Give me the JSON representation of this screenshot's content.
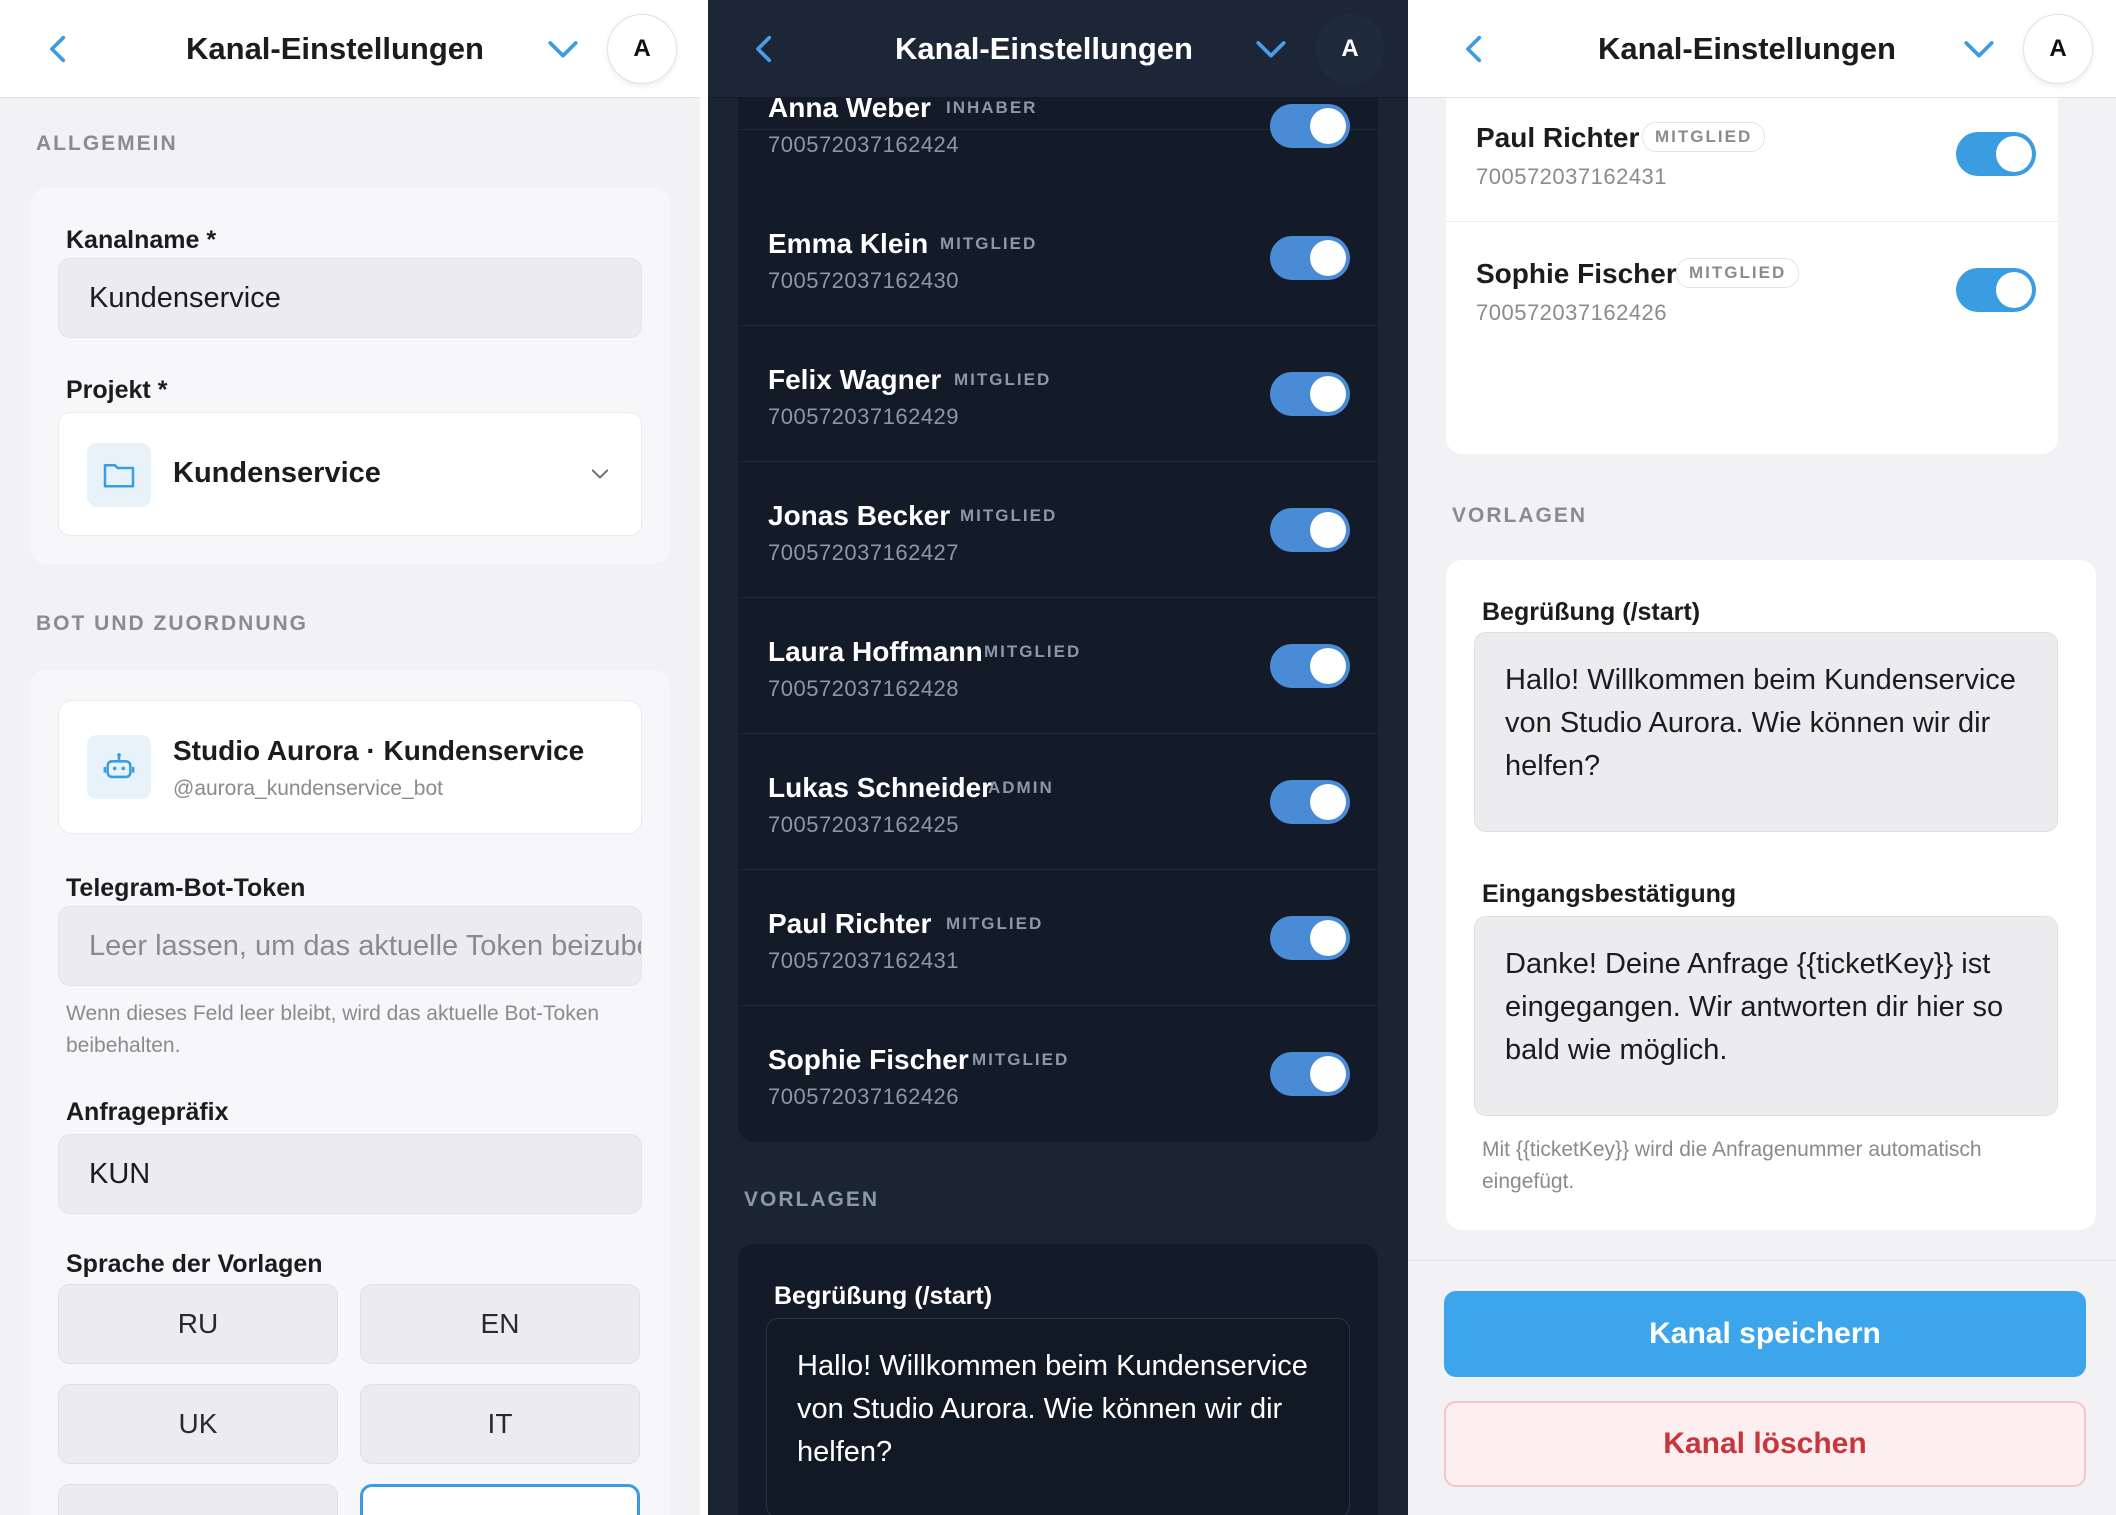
{
  "header": {
    "title": "Kanal-Einstellungen",
    "avatar": "A"
  },
  "general": {
    "section": "ALLGEMEIN",
    "channel_name_label": "Kanalname *",
    "channel_name_value": "Kundenservice",
    "project_label": "Projekt *",
    "project_value": "Kundenservice"
  },
  "bot": {
    "section": "BOT UND ZUORDNUNG",
    "name": "Studio Aurora · Kundenservice",
    "handle": "@aurora_kundenservice_bot",
    "token_label": "Telegram-Bot-Token",
    "token_placeholder": "Leer lassen, um das aktuelle Token beizubehalten",
    "token_hint": "Wenn dieses Feld leer bleibt, wird das aktuelle Bot-Token beibehalten.",
    "prefix_label": "Anfragepräfix",
    "prefix_value": "KUN",
    "language_label": "Sprache der Vorlagen",
    "languages": [
      "RU",
      "EN",
      "UK",
      "IT"
    ]
  },
  "members": [
    {
      "name": "Anna Weber",
      "role": "INHABER",
      "id": "700572037162424",
      "enabled": true
    },
    {
      "name": "Emma Klein",
      "role": "MITGLIED",
      "id": "700572037162430",
      "enabled": true
    },
    {
      "name": "Felix Wagner",
      "role": "MITGLIED",
      "id": "700572037162429",
      "enabled": true
    },
    {
      "name": "Jonas Becker",
      "role": "MITGLIED",
      "id": "700572037162427",
      "enabled": true
    },
    {
      "name": "Laura Hoffmann",
      "role": "MITGLIED",
      "id": "700572037162428",
      "enabled": true
    },
    {
      "name": "Lukas Schneider",
      "role": "ADMIN",
      "id": "700572037162425",
      "enabled": true
    },
    {
      "name": "Paul Richter",
      "role": "MITGLIED",
      "id": "700572037162431",
      "enabled": true
    },
    {
      "name": "Sophie Fischer",
      "role": "MITGLIED",
      "id": "700572037162426",
      "enabled": true
    }
  ],
  "templates": {
    "section": "VORLAGEN",
    "welcome_label": "Begrüßung (/start)",
    "welcome_text": "Hallo! Willkommen beim Kundenservice von Studio Aurora. Wie können wir dir helfen?",
    "confirm_label": "Eingangsbestätigung",
    "confirm_text": "Danke! Deine Anfrage {{ticketKey}} ist eingegangen. Wir antworten dir hier so bald wie möglich.",
    "confirm_hint": "Mit {{ticketKey}} wird die Anfragenummer automatisch eingefügt."
  },
  "actions": {
    "save": "Kanal speichern",
    "delete": "Kanal löschen"
  },
  "colors": {
    "accent": "#3da5ec",
    "dark_bg": "#1b2433",
    "danger": "#c9353c"
  }
}
